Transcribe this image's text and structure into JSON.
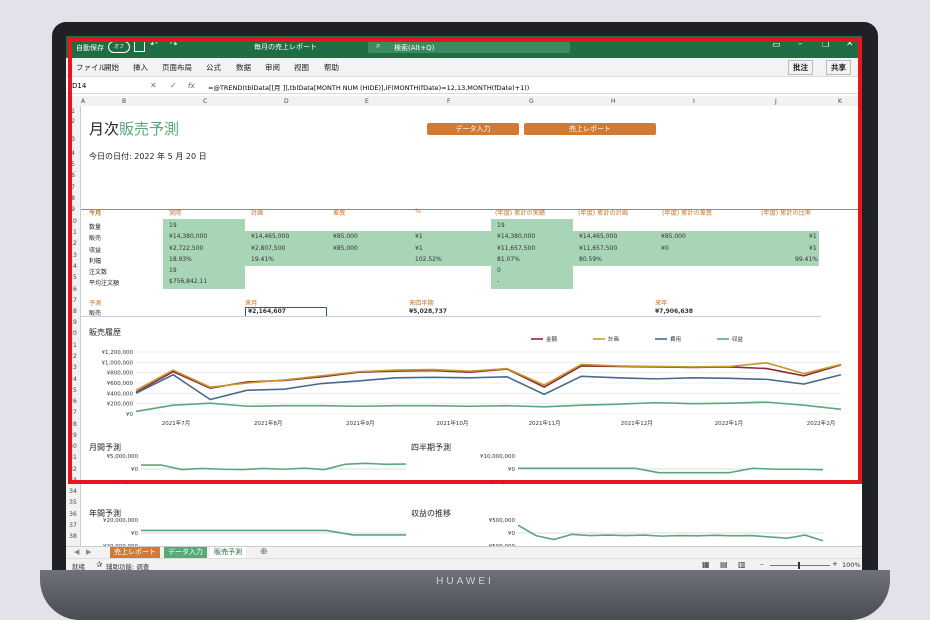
{
  "titlebar": {
    "autosave": "自動保存",
    "autosave_state": "オフ",
    "doc_title": "毎月の売上レポート",
    "search": "検索(Alt+Q)"
  },
  "menu": {
    "items": [
      "ファイル",
      "開始",
      "挿入",
      "页面布局",
      "公式",
      "数据",
      "审阅",
      "视图",
      "帮助"
    ],
    "comment": "批注",
    "share": "共享"
  },
  "formula": {
    "cell": "D14",
    "fx": "fx",
    "text": "=@TREND(tblData[[月 ]],tblData[MONTH NUM (HIDE)],IF(MONTH(fDate)=12,13,MONTH(fDate)+1))"
  },
  "columns": [
    "A",
    "B",
    "C",
    "D",
    "E",
    "F",
    "G",
    "H",
    "I",
    "J",
    "K"
  ],
  "rows": [
    "1",
    "2",
    "3",
    "4",
    "5",
    "6",
    "7",
    "8",
    "9",
    "10",
    "11",
    "12",
    "13",
    "14",
    "15",
    "16",
    "17",
    "18",
    "19",
    "20",
    "21",
    "22",
    "23",
    "24",
    "25",
    "26",
    "27",
    "28",
    "29",
    "30",
    "31",
    "32",
    "33",
    "34",
    "35",
    "36",
    "37",
    "38",
    "39",
    "40",
    "41",
    "42",
    "43"
  ],
  "sheet": {
    "title_a": "月次",
    "title_b": "販売予測",
    "btn_data": "データ入力",
    "btn_report": "売上レポート",
    "date": "今日の日付: 2022 年 5 月 20 日",
    "kpi_headers": [
      "今月",
      "実際",
      "計画",
      "差異",
      "%",
      "(年度) 累計の実績",
      "(年度) 累計の計画",
      "(年度) 累計の差異",
      "(年度) 累計の比率"
    ],
    "kpi_rows": [
      {
        "label": "数量",
        "cells": [
          "19",
          "",
          "",
          "",
          "19",
          "",
          "",
          ""
        ]
      },
      {
        "label": "販売",
        "cells": [
          "¥14,380,000",
          "¥14,465,000",
          "¥85,000",
          "¥1",
          "¥14,380,000",
          "¥14,465,000",
          "¥85,000",
          "¥1"
        ]
      },
      {
        "label": "収益",
        "cells": [
          "¥2,722,500",
          "¥2,807,500",
          "¥85,000",
          "¥1",
          "¥11,657,500",
          "¥11,657,500",
          "¥0",
          "¥1"
        ]
      },
      {
        "label": "利幅",
        "cells": [
          "18.93%",
          "19.41%",
          "",
          "102.52%",
          "81.07%",
          "80.59%",
          "",
          "99.41%"
        ]
      },
      {
        "label": "注文数",
        "cells": [
          "19",
          "",
          "",
          "",
          "0",
          "",
          "",
          ""
        ]
      },
      {
        "label": "平均注文額",
        "cells": [
          "$756,842.11",
          "",
          "",
          "",
          "-",
          "",
          "",
          ""
        ]
      }
    ],
    "forecast": {
      "h1": "予測",
      "h2": "来月",
      "h3": "来四半期",
      "h4": "来年",
      "label": "販売",
      "v1": "¥2,164,607",
      "v2": "¥5,028,737",
      "v3": "¥7,906,638"
    },
    "history_title": "販売履歴",
    "monthly_title": "月間予測",
    "quarterly_title": "四半期予測",
    "annual_title": "年間予測",
    "revenue_title": "収益の推移"
  },
  "chart_data": [
    {
      "type": "line",
      "title": "販売履歴",
      "x": [
        "2021年7月",
        "2021年8月",
        "2021年9月",
        "2021年10月",
        "2021年11月",
        "2021年12月",
        "2022年1月",
        "2022年2月"
      ],
      "yticks": [
        "¥1,200,000",
        "¥1,000,000",
        "¥800,000",
        "¥600,000",
        "¥400,000",
        "¥200,000",
        "¥0"
      ],
      "ylim": [
        0,
        1200000
      ],
      "legend_position": "top-right",
      "series": [
        {
          "name": "金額",
          "color": "#8b2a3c",
          "values": [
            420000,
            820000,
            500000,
            620000,
            650000,
            720000,
            810000,
            830000,
            840000,
            810000,
            870000,
            520000,
            930000,
            920000,
            910000,
            900000,
            910000,
            880000,
            740000,
            950000
          ]
        },
        {
          "name": "計画",
          "color": "#c79a2a",
          "values": [
            460000,
            850000,
            520000,
            600000,
            660000,
            740000,
            820000,
            850000,
            860000,
            830000,
            880000,
            560000,
            960000,
            930000,
            920000,
            910000,
            920000,
            990000,
            780000,
            960000
          ]
        },
        {
          "name": "費用",
          "color": "#4a6b8f",
          "values": [
            400000,
            760000,
            280000,
            460000,
            480000,
            590000,
            640000,
            700000,
            710000,
            700000,
            720000,
            380000,
            730000,
            700000,
            680000,
            700000,
            690000,
            670000,
            580000,
            760000
          ]
        },
        {
          "name": "収益",
          "color": "#5aa87a",
          "values": [
            50000,
            170000,
            210000,
            150000,
            160000,
            160000,
            150000,
            160000,
            160000,
            150000,
            160000,
            140000,
            170000,
            190000,
            220000,
            200000,
            210000,
            230000,
            170000,
            90000
          ]
        }
      ]
    },
    {
      "type": "line",
      "title": "月間予測",
      "yticks": [
        "¥5,000,000",
        "¥0",
        "-¥5,000,000"
      ],
      "ylim": [
        -5000000,
        5000000
      ],
      "series": [
        {
          "name": "",
          "color": "#5aa87a",
          "values": [
            1500000,
            1500000,
            -200000,
            200000,
            -100000,
            -200000,
            200000,
            -100000,
            300000,
            -200000,
            1800000,
            2200000,
            1800000,
            1900000
          ]
        }
      ]
    },
    {
      "type": "line",
      "title": "四半期予測",
      "yticks": [
        "¥10,000,000",
        "¥0",
        "-¥10,000,000"
      ],
      "ylim": [
        -10000000,
        10000000
      ],
      "series": [
        {
          "name": "",
          "color": "#5aa87a",
          "values": [
            500000,
            500000,
            500000,
            500000,
            500000,
            500000,
            -2800000,
            -2800000,
            -2800000,
            -2800000,
            500000,
            -200000,
            -200000,
            -500000
          ]
        }
      ]
    },
    {
      "type": "line",
      "title": "年間予測",
      "yticks": [
        "¥20,000,000",
        "¥0",
        "-¥20,000,000"
      ],
      "ylim": [
        -20000000,
        20000000
      ],
      "series": [
        {
          "name": "",
          "color": "#5aa87a",
          "values": [
            4000000,
            4000000,
            4000000,
            4000000,
            4000000,
            4000000,
            4000000,
            4000000,
            -3000000,
            -3000000,
            -3000000
          ]
        }
      ]
    },
    {
      "type": "line",
      "title": "収益の推移",
      "yticks": [
        "¥500,000",
        "¥0",
        "-¥500,000"
      ],
      "ylim": [
        -500000,
        500000
      ],
      "series": [
        {
          "name": "",
          "color": "#5aa87a",
          "values": [
            300000,
            -100000,
            -250000,
            -50000,
            -100000,
            -80000,
            -100000,
            -80000,
            -120000,
            -100000,
            -110000,
            -90000,
            -110000,
            -100000,
            -150000,
            -200000,
            -80000,
            -300000
          ]
        }
      ]
    }
  ],
  "tabs": {
    "t1": "売上レポート",
    "t2": "データ入力",
    "t3": "販売予測"
  },
  "status": {
    "ready": "就绪",
    "access": "辅助功能: 调查",
    "zoom": "100%"
  },
  "brand": "HUAWEI",
  "colors": {
    "excel_green": "#1f6e43",
    "accent_orange": "#d27a34",
    "cell_green": "#a8d5b5",
    "highlight": "#e8141e"
  }
}
